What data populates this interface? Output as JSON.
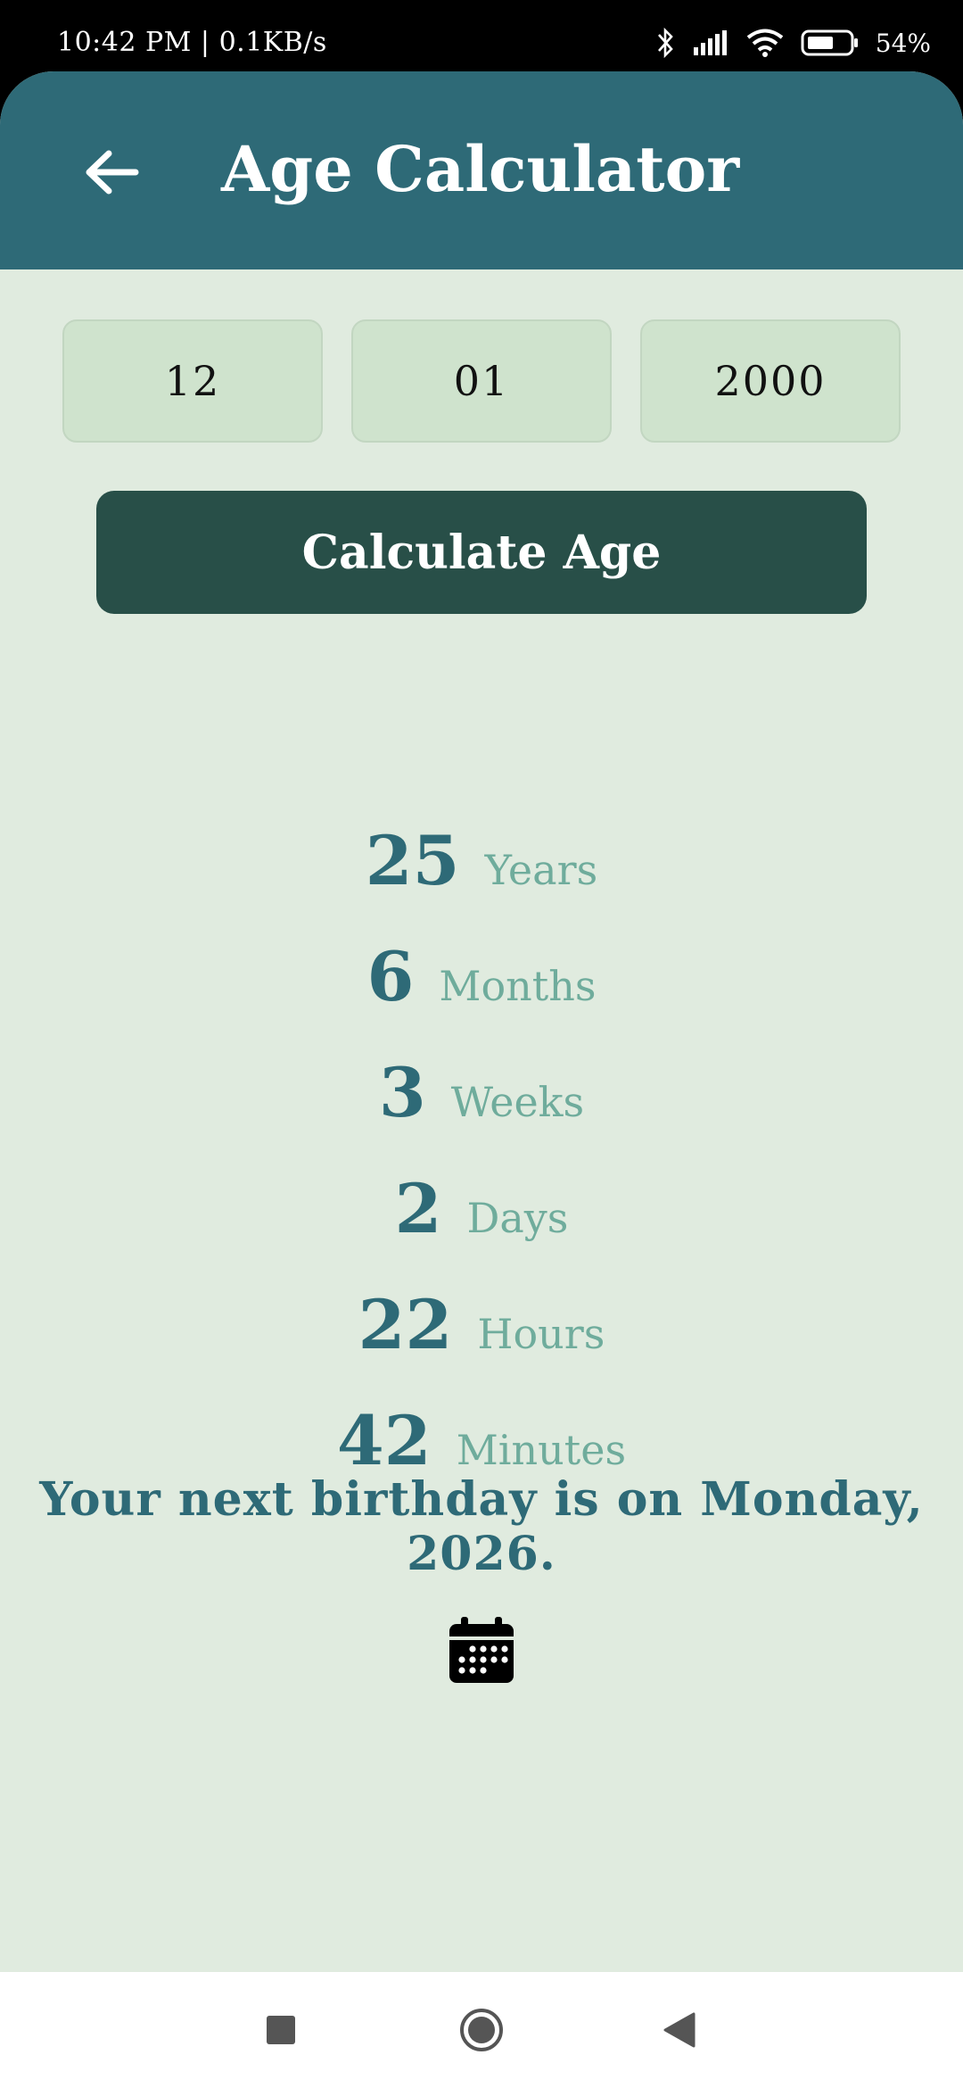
{
  "status_bar": {
    "time_speed": "10:42 PM | 0.1KB/s",
    "battery_percent": "54%",
    "icons": [
      "bluetooth-icon",
      "signal-icon",
      "wifi-icon",
      "battery-icon"
    ]
  },
  "header": {
    "title": "Age Calculator",
    "back_icon": "arrow-left-icon"
  },
  "date_inputs": {
    "day": "12",
    "month": "01",
    "year": "2000"
  },
  "calculate_button": {
    "label": "Calculate Age"
  },
  "results": [
    {
      "value": "25",
      "unit": "Years"
    },
    {
      "value": "6",
      "unit": "Months"
    },
    {
      "value": "3",
      "unit": "Weeks"
    },
    {
      "value": "2",
      "unit": "Days"
    },
    {
      "value": "22",
      "unit": "Hours"
    },
    {
      "value": "42",
      "unit": "Minutes"
    }
  ],
  "next_birthday_text": "Your next birthday is on Monday, 2026.",
  "calendar_icon": "calendar-icon",
  "nav_bar": {
    "icons": [
      "recents-square-icon",
      "home-circle-icon",
      "back-triangle-icon"
    ]
  },
  "colors": {
    "header_bg": "#2e6a77",
    "body_bg": "#e0ebdf",
    "button_bg": "#284f48",
    "number_color": "#2e6a77",
    "unit_color": "#6fac9c"
  }
}
